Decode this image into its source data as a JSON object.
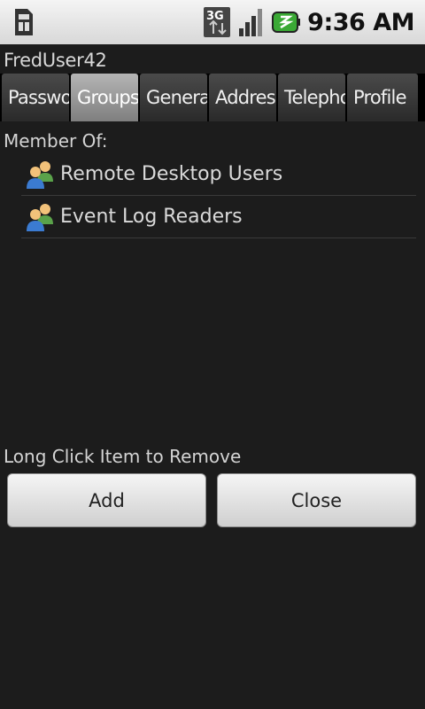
{
  "status_bar": {
    "time": "9:36 AM",
    "icons": [
      "sim-card-icon",
      "3g-data-icon",
      "signal-strength-icon",
      "battery-charging-icon"
    ]
  },
  "window": {
    "title": "FredUser42"
  },
  "tabs": [
    {
      "label": "Password",
      "selected": false
    },
    {
      "label": "Groups",
      "selected": true
    },
    {
      "label": "General",
      "selected": false
    },
    {
      "label": "Address",
      "selected": false
    },
    {
      "label": "Telephones",
      "selected": false
    },
    {
      "label": "Profile",
      "selected": false
    }
  ],
  "main": {
    "member_of_label": "Member Of:",
    "groups": [
      {
        "label": "Remote Desktop Users",
        "icon": "user-group-icon"
      },
      {
        "label": "Event Log Readers",
        "icon": "user-group-icon"
      }
    ],
    "hint": "Long Click Item to Remove"
  },
  "actions": {
    "add_label": "Add",
    "close_label": "Close"
  },
  "colors": {
    "background": "#1c1c1c",
    "tab_selected": "#9a9a9a",
    "tab_normal": "#3a3a3a",
    "button": "#e4e4e4"
  }
}
